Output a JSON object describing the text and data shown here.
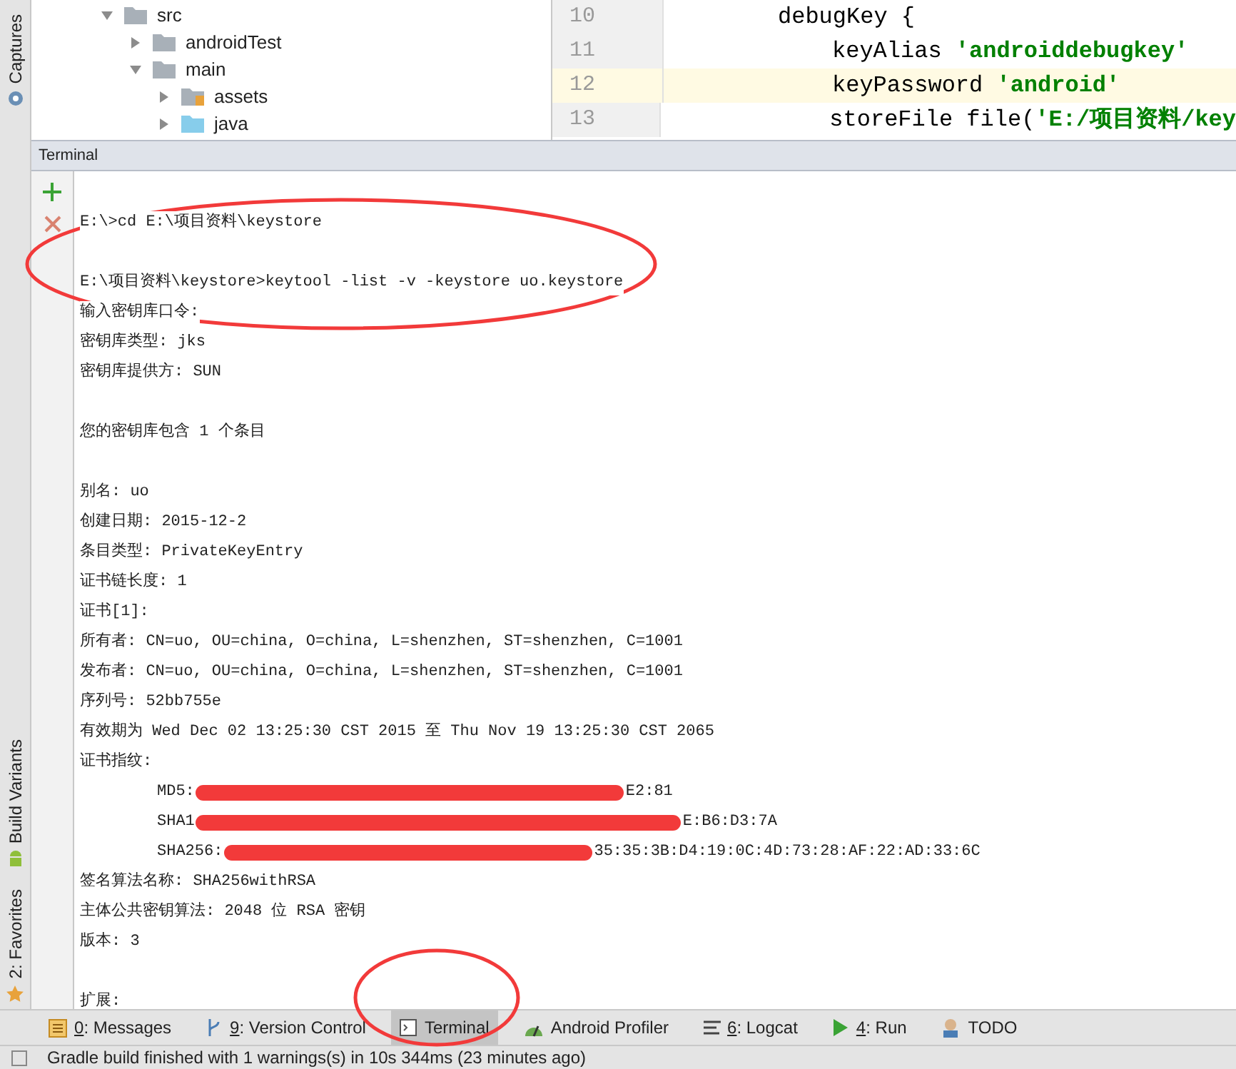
{
  "side_tabs": [
    {
      "label": "Captures",
      "kind": "captures"
    },
    {
      "label": "Build Variants",
      "kind": "build"
    },
    {
      "label": "2: Favorites",
      "kind": "favorites"
    }
  ],
  "project_tree": [
    {
      "label": "src",
      "expanded": true,
      "kind": "folder",
      "children": [
        {
          "label": "androidTest",
          "expanded": false,
          "kind": "folder"
        },
        {
          "label": "main",
          "expanded": true,
          "kind": "folder",
          "children": [
            {
              "label": "assets",
              "expanded": false,
              "kind": "assets"
            },
            {
              "label": "java",
              "expanded": false,
              "kind": "java"
            }
          ]
        }
      ]
    }
  ],
  "editor": {
    "lines": [
      {
        "number": "10",
        "selected": false,
        "tokens": [
          {
            "kind": "plain",
            "text": "debugKey {"
          }
        ],
        "children": [
          {
            "number": "11",
            "selected": false,
            "tokens": [
              {
                "kind": "plain",
                "text": "keyAlias "
              },
              {
                "kind": "string",
                "text": "'androiddebugkey'"
              }
            ]
          },
          {
            "number": "12",
            "selected": true,
            "tokens": [
              {
                "kind": "plain",
                "text": "keyPassword "
              },
              {
                "kind": "string",
                "text": "'android'"
              }
            ]
          },
          {
            "number": "13",
            "selected": false,
            "tokens": [
              {
                "kind": "plain",
                "text": "storeFile file("
              },
              {
                "kind": "string",
                "text": "'E:/项目资料/key"
              }
            ]
          }
        ]
      }
    ]
  },
  "terminal": {
    "title": "Terminal",
    "lines": [
      {
        "kind": "text",
        "text": "E:\\>cd E:\\项目资料\\keystore"
      },
      {
        "kind": "blank"
      },
      {
        "kind": "text",
        "text": "E:\\项目资料\\keystore>keytool -list -v -keystore uo.keystore"
      },
      {
        "kind": "text",
        "text": "输入密钥库口令:"
      },
      {
        "kind": "text",
        "text": "密钥库类型: jks"
      },
      {
        "kind": "text",
        "text": "密钥库提供方: SUN"
      },
      {
        "kind": "blank"
      },
      {
        "kind": "text",
        "text": "您的密钥库包含 1 个条目"
      },
      {
        "kind": "blank"
      },
      {
        "kind": "text",
        "text": "别名: uo"
      },
      {
        "kind": "text",
        "text": "创建日期: 2015-12-2"
      },
      {
        "kind": "text",
        "text": "条目类型: PrivateKeyEntry"
      },
      {
        "kind": "text",
        "text": "证书链长度: 1"
      },
      {
        "kind": "text",
        "text": "证书[1]:"
      },
      {
        "kind": "text",
        "text": "所有者: CN=uo, OU=china, O=china, L=shenzhen, ST=shenzhen, C=1001"
      },
      {
        "kind": "text",
        "text": "发布者: CN=uo, OU=china, O=china, L=shenzhen, ST=shenzhen, C=1001"
      },
      {
        "kind": "text",
        "text": "序列号: 52bb755e"
      },
      {
        "kind": "text",
        "text": "有效期为 Wed Dec 02 13:25:30 CST 2015 至 Thu Nov 19 13:25:30 CST 2065"
      },
      {
        "kind": "text",
        "text": "证书指纹:"
      },
      {
        "kind": "fingerprint",
        "prefix": "MD5:",
        "suffix": "E2:81"
      },
      {
        "kind": "fingerprint",
        "prefix": "SHA1",
        "suffix": "E:B6:D3:7A"
      },
      {
        "kind": "fingerprint",
        "prefix": "SHA256:",
        "suffix": "35:35:3B:D4:19:0C:4D:73:28:AF:22:AD:33:6C"
      },
      {
        "kind": "text",
        "text": "签名算法名称: SHA256withRSA"
      },
      {
        "kind": "text",
        "text": "主体公共密钥算法: 2048 位 RSA 密钥"
      },
      {
        "kind": "text",
        "text": "版本: 3"
      },
      {
        "kind": "blank"
      },
      {
        "kind": "text",
        "text": "扩展:"
      }
    ]
  },
  "tool_tabs": [
    {
      "mnemonic": "0",
      "label": ": Messages",
      "kind": "messages",
      "selected": false
    },
    {
      "mnemonic": "9",
      "label": ": Version Control",
      "kind": "vcs",
      "selected": false
    },
    {
      "label": "Terminal",
      "kind": "terminal",
      "selected": true
    },
    {
      "label": "Android Profiler",
      "kind": "profiler",
      "selected": false
    },
    {
      "mnemonic": "6",
      "label": ": Logcat",
      "kind": "logcat",
      "selected": false
    },
    {
      "mnemonic": "4",
      "label": ": Run",
      "kind": "run",
      "selected": false
    },
    {
      "label": "TODO",
      "kind": "todo",
      "selected": false
    }
  ],
  "status_bar": "Gradle build finished with 1 warnings(s) in 10s 344ms (23 minutes ago)"
}
